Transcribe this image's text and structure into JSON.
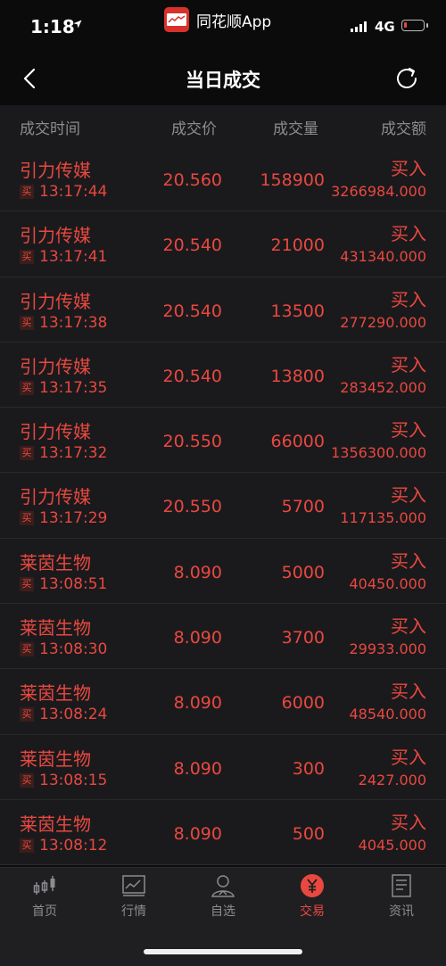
{
  "status_bar": {
    "time": "1:18",
    "app_name": "同花顺App",
    "network": "4G",
    "battery_color": "#e9483f",
    "battery_level": 0.15
  },
  "nav": {
    "title": "当日成交",
    "back_icon": "chevron-left-icon",
    "refresh_icon": "refresh-icon"
  },
  "table": {
    "headers": {
      "time": "成交时间",
      "price": "成交价",
      "volume": "成交量",
      "amount": "成交额"
    },
    "rows": [
      {
        "name": "引力传媒",
        "tag": "买",
        "time": "13:17:44",
        "price": "20.560",
        "volume": "158900",
        "direction": "买入",
        "amount": "3266984.000"
      },
      {
        "name": "引力传媒",
        "tag": "买",
        "time": "13:17:41",
        "price": "20.540",
        "volume": "21000",
        "direction": "买入",
        "amount": "431340.000"
      },
      {
        "name": "引力传媒",
        "tag": "买",
        "time": "13:17:38",
        "price": "20.540",
        "volume": "13500",
        "direction": "买入",
        "amount": "277290.000"
      },
      {
        "name": "引力传媒",
        "tag": "买",
        "time": "13:17:35",
        "price": "20.540",
        "volume": "13800",
        "direction": "买入",
        "amount": "283452.000"
      },
      {
        "name": "引力传媒",
        "tag": "买",
        "time": "13:17:32",
        "price": "20.550",
        "volume": "66000",
        "direction": "买入",
        "amount": "1356300.000"
      },
      {
        "name": "引力传媒",
        "tag": "买",
        "time": "13:17:29",
        "price": "20.550",
        "volume": "5700",
        "direction": "买入",
        "amount": "117135.000"
      },
      {
        "name": "莱茵生物",
        "tag": "买",
        "time": "13:08:51",
        "price": "8.090",
        "volume": "5000",
        "direction": "买入",
        "amount": "40450.000"
      },
      {
        "name": "莱茵生物",
        "tag": "买",
        "time": "13:08:30",
        "price": "8.090",
        "volume": "3700",
        "direction": "买入",
        "amount": "29933.000"
      },
      {
        "name": "莱茵生物",
        "tag": "买",
        "time": "13:08:24",
        "price": "8.090",
        "volume": "6000",
        "direction": "买入",
        "amount": "48540.000"
      },
      {
        "name": "莱茵生物",
        "tag": "买",
        "time": "13:08:15",
        "price": "8.090",
        "volume": "300",
        "direction": "买入",
        "amount": "2427.000"
      },
      {
        "name": "莱茵生物",
        "tag": "买",
        "time": "13:08:12",
        "price": "8.090",
        "volume": "500",
        "direction": "买入",
        "amount": "4045.000"
      }
    ]
  },
  "tabs": [
    {
      "label": "首页",
      "icon": "candlestick-icon",
      "active": false
    },
    {
      "label": "行情",
      "icon": "chart-icon",
      "active": false
    },
    {
      "label": "自选",
      "icon": "user-icon",
      "active": false
    },
    {
      "label": "交易",
      "icon": "yen-icon",
      "active": true
    },
    {
      "label": "资讯",
      "icon": "document-icon",
      "active": false
    }
  ],
  "colors": {
    "accent": "#e9483f",
    "background": "#1a1a1d",
    "muted": "#8c8c90"
  }
}
